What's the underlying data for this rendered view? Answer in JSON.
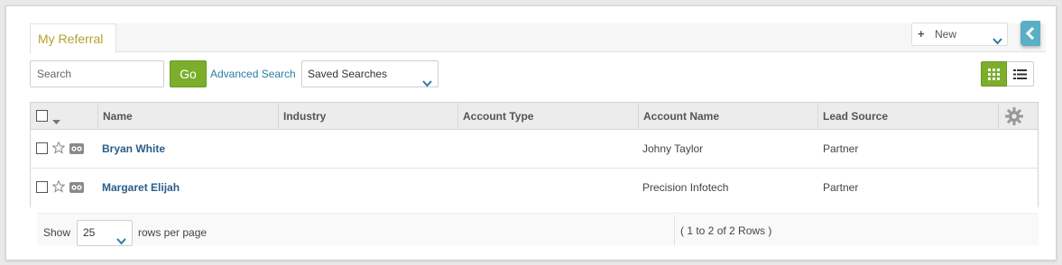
{
  "tabs": [
    {
      "label": "My Referral",
      "active": true
    }
  ],
  "new_button": {
    "label": "New",
    "icon": "plus-icon"
  },
  "collapse_button": {
    "icon": "chevron-left-icon"
  },
  "search": {
    "placeholder": "Search",
    "value": "",
    "go_label": "Go",
    "advanced_label": "Advanced Search",
    "saved_searches_value": "Saved Searches"
  },
  "view_toggle": {
    "grid_icon": "grid-view-icon",
    "list_icon": "list-view-icon",
    "active": "grid"
  },
  "table": {
    "columns": [
      "Name",
      "Industry",
      "Account Type",
      "Account Name",
      "Lead Source"
    ],
    "rows": [
      {
        "name": "Bryan White",
        "industry": "",
        "account_type": "",
        "account_name": "Johny Taylor",
        "lead_source": "Partner"
      },
      {
        "name": "Margaret Elijah",
        "industry": "",
        "account_type": "",
        "account_name": "Precision Infotech",
        "lead_source": "Partner"
      }
    ]
  },
  "footer": {
    "show_label": "Show",
    "rows_per_page_value": "25",
    "rows_per_page_label": "rows per page",
    "pager_info": "( 1 to 2 of 2 Rows )"
  },
  "colors": {
    "tab_text": "#b5a22c",
    "go_button": "#7cae2b",
    "link": "#2a7da0",
    "name_link": "#2a5d88",
    "collapse_button": "#5aaec5"
  }
}
